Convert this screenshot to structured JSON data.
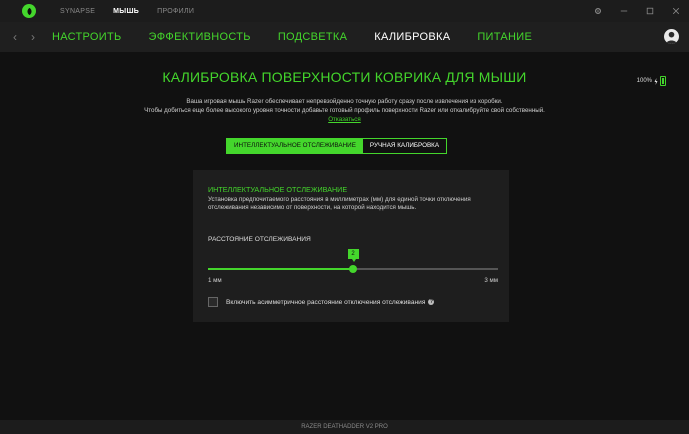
{
  "topnav": {
    "items": [
      "SYNAPSE",
      "МЫШЬ",
      "ПРОФИЛИ"
    ],
    "active_index": 1
  },
  "window_controls": {
    "settings_icon": "gear-icon",
    "minimize_icon": "minimize-icon",
    "maximize_icon": "maximize-icon",
    "close_icon": "close-icon"
  },
  "subnav": {
    "items": [
      "НАСТРОИТЬ",
      "ЭФФЕКТИВНОСТЬ",
      "ПОДСВЕТКА",
      "КАЛИБРОВКА",
      "ПИТАНИЕ"
    ],
    "active_index": 3
  },
  "page": {
    "title": "КАЛИБРОВКА ПОВЕРХНОСТИ КОВРИКА ДЛЯ МЫШИ",
    "battery": "100%",
    "description_line1": "Ваша игровая мышь Razer обеспечивает непревзойденно точную работу сразу после извлечения из коробки.",
    "description_line2": "Чтобы добиться еще более высокого уровня точности добавьте готовый профиль поверхности Razer или откалибруйте свой собственный.",
    "dismiss_link": "Отказаться"
  },
  "mode_tabs": {
    "smart": "ИНТЕЛЛЕКТУАЛЬНОЕ ОТСЛЕЖИВАНИЕ",
    "manual": "РУЧНАЯ КАЛИБРОВКА"
  },
  "smart_tracking": {
    "title": "ИНТЕЛЛЕКТУАЛЬНОЕ ОТСЛЕЖИВАНИЕ",
    "description": "Установка предпочитаемого расстояния в миллиметрах (мм) для единой точки отключения отслеживания независимо от поверхности, на которой находится мышь.",
    "distance_label": "РАССТОЯНИЕ ОТСЛЕЖИВАНИЯ",
    "slider": {
      "min": 1,
      "max": 3,
      "value": 2
    },
    "min_label": "1 мм",
    "max_label": "3 мм",
    "asymmetric_label": "Включить асимметричное расстояние отключения отслеживания",
    "asymmetric_checked": false
  },
  "footer": {
    "device": "RAZER DEATHADDER V2 PRO"
  },
  "colors": {
    "accent": "#44d62c"
  }
}
